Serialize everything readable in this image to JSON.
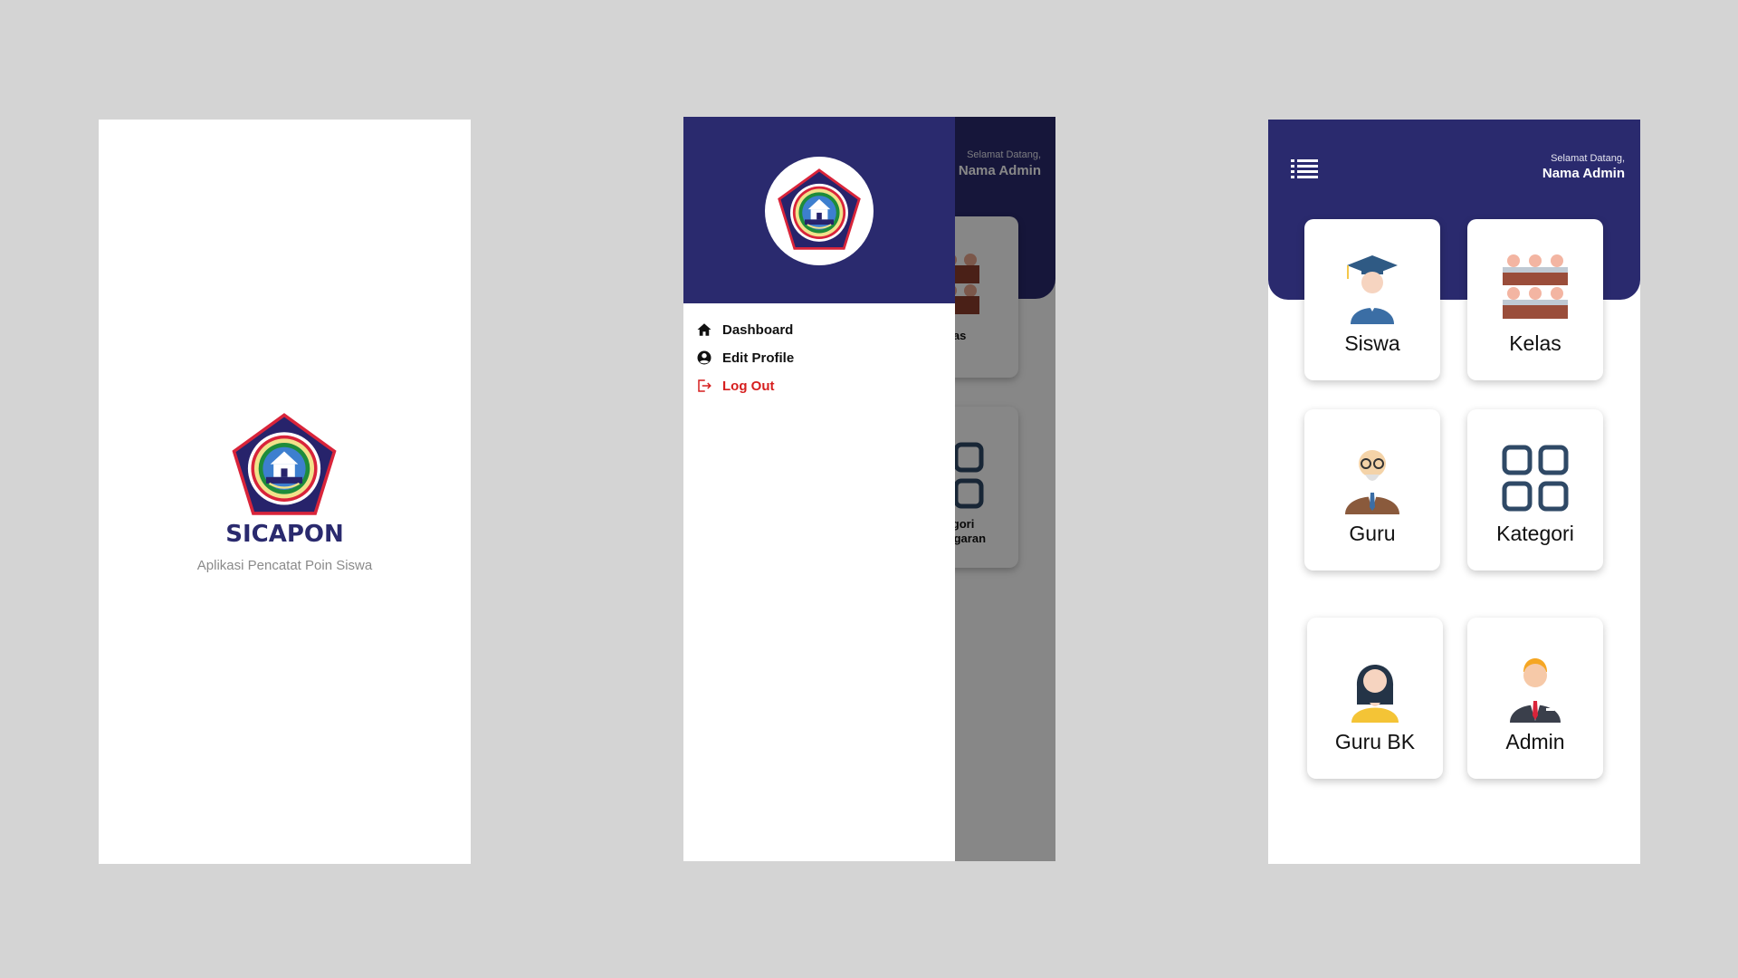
{
  "splash": {
    "title": "SICAPON",
    "subtitle": "Aplikasi Pencatat Poin Siswa"
  },
  "drawer": {
    "menu": [
      {
        "label": "Dashboard",
        "icon": "home-icon"
      },
      {
        "label": "Edit Profile",
        "icon": "user-circle-icon"
      },
      {
        "label": "Log Out",
        "icon": "logout-icon"
      }
    ],
    "behind": {
      "welcome": "Selamat Datang,",
      "name": "Nama Admin",
      "card_kelas": "Kelas",
      "card_kategori_line1": "Kategori",
      "card_kategori_line2": "Pelanggaran"
    }
  },
  "dashboard": {
    "welcome": "Selamat Datang,",
    "name": "Nama Admin",
    "cards": [
      {
        "label": "Siswa",
        "icon": "student-icon"
      },
      {
        "label": "Kelas",
        "icon": "classroom-icon"
      },
      {
        "label": "Guru",
        "icon": "teacher-icon"
      },
      {
        "label": "Kategori",
        "icon": "grid-icon"
      },
      {
        "label": "Guru BK",
        "icon": "counselor-icon"
      },
      {
        "label": "Admin",
        "icon": "admin-icon"
      }
    ]
  },
  "colors": {
    "background": "#d4d4d4",
    "primary": "#2a2a6e",
    "logout": "#d61f1f",
    "scrim": "#000000"
  }
}
